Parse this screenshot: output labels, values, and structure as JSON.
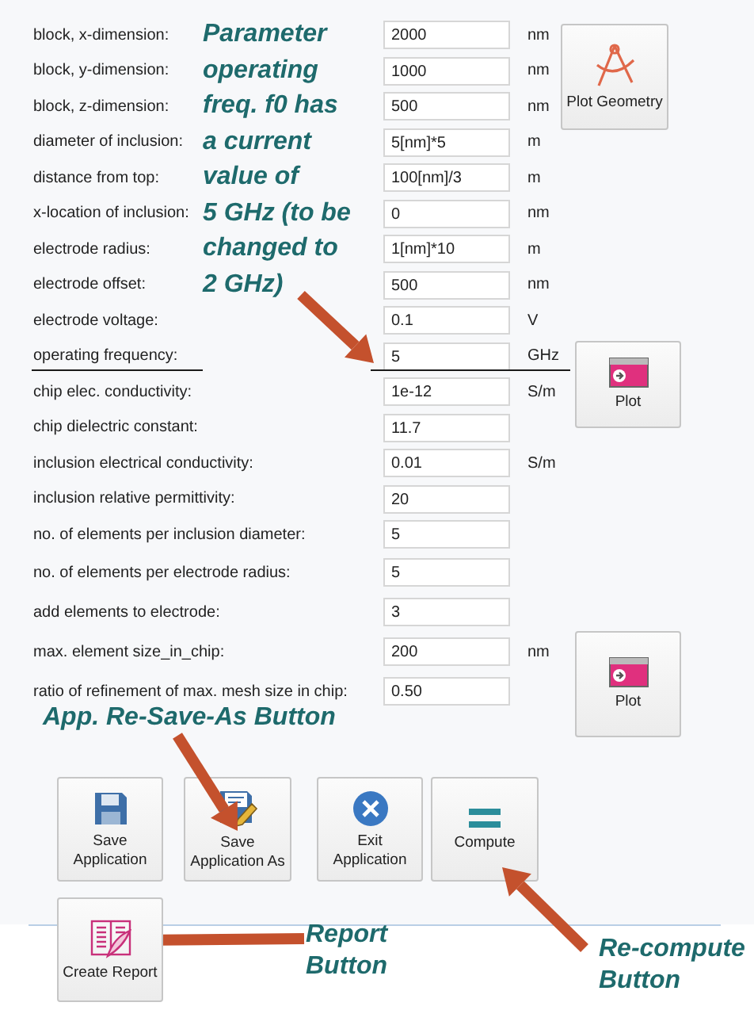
{
  "rows": [
    {
      "label": "block, x-dimension:",
      "value": "2000",
      "unit": "nm",
      "highlighted": false
    },
    {
      "label": "block, y-dimension:",
      "value": "1000",
      "unit": "nm",
      "highlighted": false
    },
    {
      "label": "block, z-dimension:",
      "value": "500",
      "unit": "nm",
      "highlighted": false
    },
    {
      "label": "diameter of inclusion:",
      "value": "5[nm]*5",
      "unit": "m",
      "highlighted": false
    },
    {
      "label": "distance from top:",
      "value": "100[nm]/3",
      "unit": "m",
      "highlighted": false
    },
    {
      "label": "x-location of inclusion:",
      "value": "0",
      "unit": "nm",
      "highlighted": false
    },
    {
      "label": "electrode radius:",
      "value": "1[nm]*10",
      "unit": "m",
      "highlighted": false
    },
    {
      "label": "electrode offset:",
      "value": "500",
      "unit": "nm",
      "highlighted": false
    },
    {
      "label": "electrode voltage:",
      "value": "0.1",
      "unit": "V",
      "highlighted": false
    },
    {
      "label": "operating frequency:",
      "value": "5",
      "unit": "GHz",
      "highlighted": true
    },
    {
      "label": "chip elec. conductivity:",
      "value": "1e-12",
      "unit": "S/m",
      "highlighted": false
    },
    {
      "label": "chip dielectric constant:",
      "value": "11.7",
      "highlighted": false
    },
    {
      "label": "inclusion electrical conductivity:",
      "value": "0.01",
      "unit": "S/m",
      "highlighted": false
    },
    {
      "label": "inclusion relative permittivity:",
      "value": "20",
      "highlighted": false
    },
    {
      "label": "no. of elements per inclusion diameter:",
      "value": "5",
      "highlighted": false
    },
    {
      "label": "no. of elements per electrode radius:",
      "value": "5",
      "highlighted": false
    },
    {
      "label": "add elements to electrode:",
      "value": "3",
      "highlighted": false
    },
    {
      "label": "max. element size_in_chip:",
      "value": "200",
      "unit": "nm",
      "highlighted": false
    },
    {
      "label": "ratio of refinement of max. mesh size in chip:",
      "value": "0.50",
      "highlighted": false
    }
  ],
  "side_buttons": [
    {
      "kind": "geometry",
      "label": "Plot Geometry"
    },
    {
      "kind": "plot",
      "label": "Plot"
    },
    {
      "kind": "plot",
      "label": "Plot"
    }
  ],
  "app_buttons": [
    {
      "kind": "save",
      "label": "Save Application"
    },
    {
      "kind": "save-as",
      "label": "Save Application As"
    },
    {
      "kind": "exit",
      "label": "Exit Application"
    },
    {
      "kind": "compute",
      "label": "Compute"
    },
    {
      "kind": "report",
      "label": "Create Report"
    }
  ],
  "annotations": [
    {
      "lines": [
        "Parameter",
        "operating",
        "freq. f0  has",
        "a current",
        "value of",
        "5 GHz (to be",
        "changed to",
        "2 GHz)"
      ]
    },
    {
      "lines": [
        "App. Re-Save-As Button"
      ]
    },
    {
      "lines": [
        "Report",
        "Button"
      ]
    },
    {
      "lines": [
        "Re-compute",
        "Button"
      ]
    }
  ]
}
